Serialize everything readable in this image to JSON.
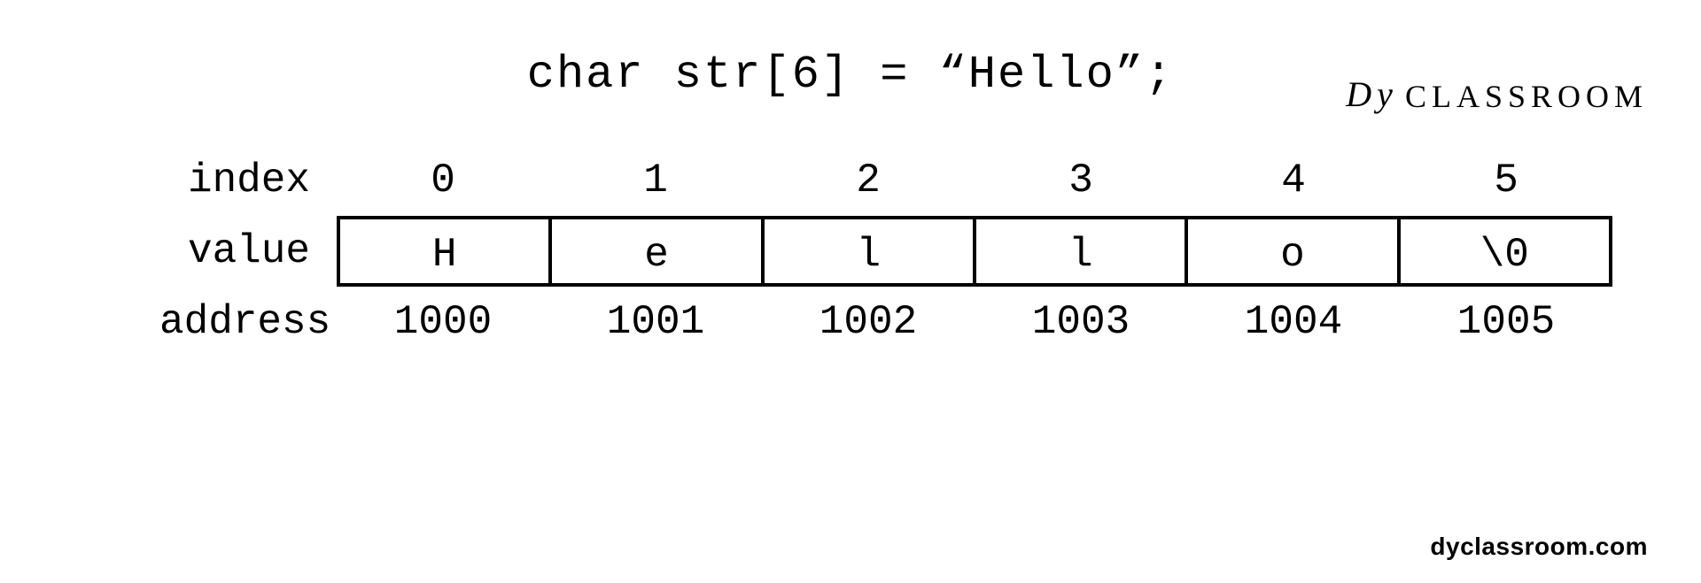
{
  "brand": {
    "icon": "Dy",
    "text": "CLASSROOM"
  },
  "declaration": "char str[6] = “Hello”;",
  "labels": {
    "index": "index",
    "value": "value",
    "address": "address"
  },
  "cells": [
    {
      "index": "0",
      "value": "H",
      "address": "1000"
    },
    {
      "index": "1",
      "value": "e",
      "address": "1001"
    },
    {
      "index": "2",
      "value": "l",
      "address": "1002"
    },
    {
      "index": "3",
      "value": "l",
      "address": "1003"
    },
    {
      "index": "4",
      "value": "o",
      "address": "1004"
    },
    {
      "index": "5",
      "value": "\\0",
      "address": "1005"
    }
  ],
  "footer": "dyclassroom.com"
}
